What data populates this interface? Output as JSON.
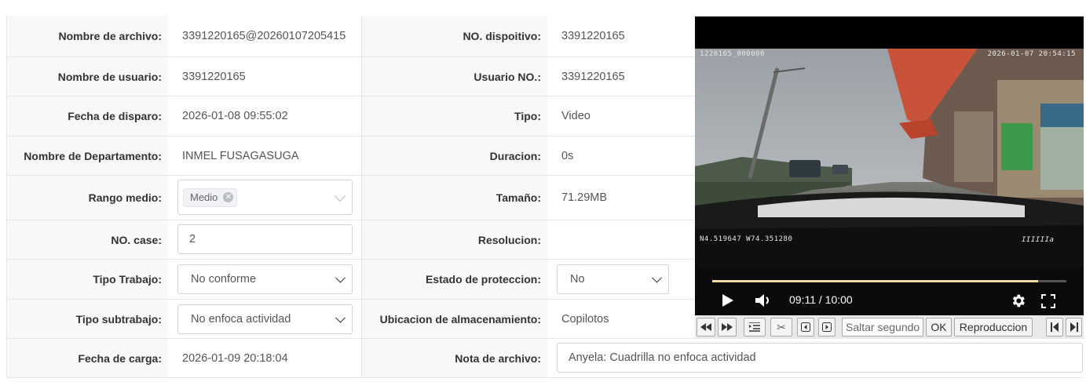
{
  "fields": {
    "file_name": {
      "label": "Nombre de archivo:",
      "value": "3391220165@20260107205415"
    },
    "device_no": {
      "label": "NO. dispoitivo:",
      "value": "3391220165"
    },
    "user_name": {
      "label": "Nombre de usuario:",
      "value": "3391220165"
    },
    "user_no": {
      "label": "Usuario NO.:",
      "value": "3391220165"
    },
    "shot_date": {
      "label": "Fecha de disparo:",
      "value": "2026-01-08 09:55:02"
    },
    "type": {
      "label": "Tipo:",
      "value": "Video"
    },
    "department": {
      "label": "Nombre de Departamento:",
      "value": "INMEL FUSAGASUGA"
    },
    "duration": {
      "label": "Duracion:",
      "value": "0s"
    },
    "medium_range": {
      "label": "Rango medio:",
      "tag": "Medio"
    },
    "size": {
      "label": "Tamaño:",
      "value": "71.29MB"
    },
    "case_no": {
      "label": "NO. case:",
      "value": "2"
    },
    "resolution": {
      "label": "Resolucion:",
      "value": ""
    },
    "work_type": {
      "label": "Tipo Trabajo:",
      "value": "No conforme"
    },
    "protection": {
      "label": "Estado de proteccion:",
      "value": "No"
    },
    "work_subtype": {
      "label": "Tipo subtrabajo:",
      "value": "No enfoca actividad"
    },
    "storage": {
      "label": "Ubicacion de almacenamiento:",
      "value": "Copilotos"
    },
    "upload_date": {
      "label": "Fecha de carga:",
      "value": "2026-01-09 20:18:04"
    },
    "file_note": {
      "label": "Nota de archivo:",
      "value": "Anyela: Cuadrilla no enfoca actividad"
    }
  },
  "video": {
    "osd_top_left": "1220165_000000",
    "osd_top_right": "2026-01-07 20:54:15",
    "osd_gps": "N4.519647  W74.351280",
    "osd_brand": "IIIIIIa",
    "time": "09:11 / 10:00",
    "progress": 0.92,
    "icons": [
      "play-icon",
      "volume-icon",
      "settings-icon",
      "fullscreen-icon"
    ]
  },
  "toolbar": {
    "jump_placeholder": "Saltar segundos",
    "ok_label": "OK",
    "playback_label": "Reproduccion",
    "icons": [
      "rewind-icon",
      "fast-forward-icon",
      "list-icon",
      "scissors-icon",
      "prev-frame-icon",
      "next-frame-icon",
      "skip-start-icon",
      "skip-end-icon"
    ]
  }
}
